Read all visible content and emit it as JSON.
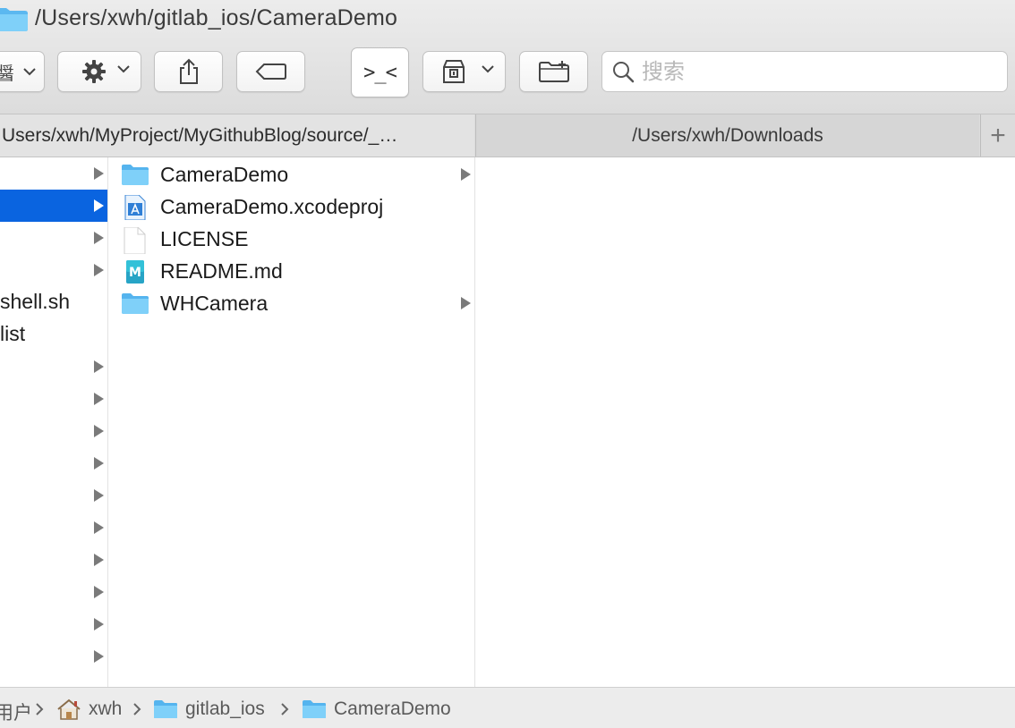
{
  "window": {
    "title": "/Users/xwh/gitlab_ios/CameraDemo",
    "title_icon": "folder-icon"
  },
  "toolbar": {
    "view_button_partial_label": "醤",
    "action_button_icon": "gear-icon",
    "share_button_icon": "share-icon",
    "tag_button_icon": "tag-icon",
    "terminal_button_label": ">_<",
    "terminal_button_active": true,
    "archive_button_icon": "archive-icon",
    "new_folder_button_icon": "new-folder-icon",
    "search_placeholder": "搜索"
  },
  "tabs": [
    {
      "label": "Users/xwh/MyProject/MyGithubBlog/source/_…",
      "active": true
    },
    {
      "label": "/Users/xwh/Downloads",
      "active": false
    }
  ],
  "tab_add_label": "+",
  "columns": {
    "first": [
      {
        "label": "",
        "has_arrow": true,
        "selected": false
      },
      {
        "label": "",
        "has_arrow": true,
        "selected": true
      },
      {
        "label": "",
        "has_arrow": true,
        "selected": false
      },
      {
        "label": "",
        "has_arrow": true,
        "selected": false
      },
      {
        "label": "shell.sh",
        "has_arrow": false,
        "selected": false
      },
      {
        "label": "list",
        "has_arrow": false,
        "selected": false
      },
      {
        "label": "",
        "has_arrow": true,
        "selected": false
      },
      {
        "label": "",
        "has_arrow": true,
        "selected": false
      },
      {
        "label": "",
        "has_arrow": true,
        "selected": false
      },
      {
        "label": "",
        "has_arrow": true,
        "selected": false
      },
      {
        "label": "",
        "has_arrow": true,
        "selected": false
      },
      {
        "label": "",
        "has_arrow": true,
        "selected": false
      },
      {
        "label": "",
        "has_arrow": true,
        "selected": false
      },
      {
        "label": "",
        "has_arrow": true,
        "selected": false
      },
      {
        "label": "",
        "has_arrow": true,
        "selected": false
      },
      {
        "label": "",
        "has_arrow": true,
        "selected": false
      }
    ],
    "second": [
      {
        "name": "CameraDemo",
        "icon": "folder-icon",
        "has_arrow": true
      },
      {
        "name": "CameraDemo.xcodeproj",
        "icon": "xcodeproj-icon",
        "has_arrow": false
      },
      {
        "name": "LICENSE",
        "icon": "document-icon",
        "has_arrow": false
      },
      {
        "name": "README.md",
        "icon": "markdown-icon",
        "has_arrow": false
      },
      {
        "name": "WHCamera",
        "icon": "folder-icon",
        "has_arrow": true
      }
    ]
  },
  "pathbar": {
    "items": [
      {
        "label": "用户",
        "icon": ""
      },
      {
        "label": "xwh",
        "icon": "home-icon"
      },
      {
        "label": "gitlab_ios",
        "icon": "folder-icon"
      },
      {
        "label": "CameraDemo",
        "icon": "folder-icon"
      }
    ]
  },
  "colors": {
    "selection": "#0a64e0",
    "folder": "#6cc4f5",
    "toolbar_bg": "#e4e4e4"
  }
}
